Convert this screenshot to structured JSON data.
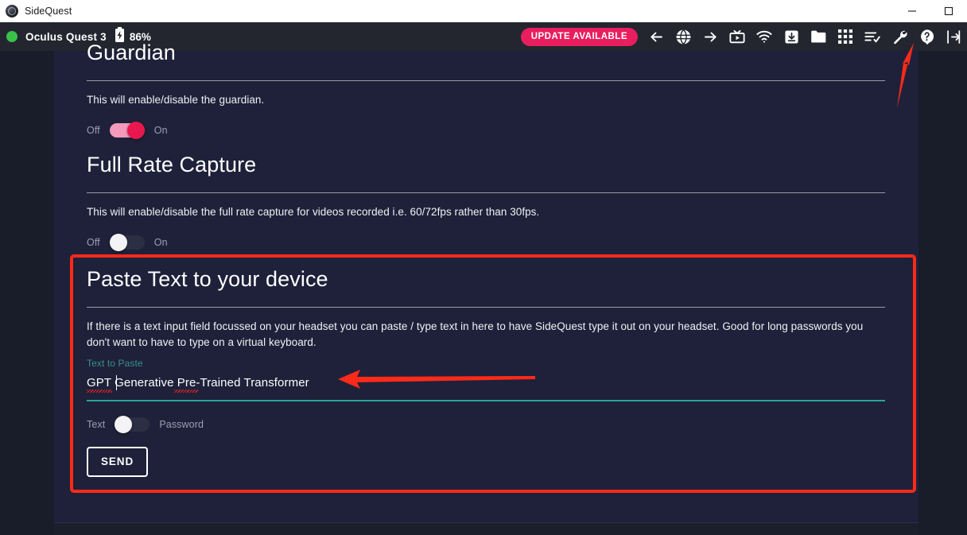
{
  "window": {
    "title": "SideQuest",
    "logo_icon": "sidequest-logo-icon",
    "minimize_label": "minimize-icon",
    "maximize_label": "maximize-icon"
  },
  "toolbar": {
    "status_icon": "connected-status-dot",
    "device_name": "Oculus Quest 3",
    "battery_icon": "battery-icon",
    "battery_percent": "86%",
    "update_badge": "UPDATE AVAILABLE",
    "icons": [
      {
        "name": "back-arrow-icon",
        "label": "Back"
      },
      {
        "name": "globe-icon",
        "label": "Browser"
      },
      {
        "name": "forward-arrow-icon",
        "label": "Forward"
      },
      {
        "name": "media-tv-icon",
        "label": "Media"
      },
      {
        "name": "wifi-icon",
        "label": "Wireless"
      },
      {
        "name": "download-icon",
        "label": "Downloads"
      },
      {
        "name": "folder-icon",
        "label": "Files"
      },
      {
        "name": "apps-grid-icon",
        "label": "Apps"
      },
      {
        "name": "task-list-icon",
        "label": "Tasks"
      },
      {
        "name": "wrench-icon",
        "label": "Tools"
      },
      {
        "name": "help-icon",
        "label": "Help"
      },
      {
        "name": "exit-icon",
        "label": "Exit"
      }
    ]
  },
  "sections": {
    "guardian": {
      "title": "Guardian",
      "description": "This will enable/disable the guardian.",
      "toggle": {
        "off_label": "Off",
        "on_label": "On",
        "state": "on"
      }
    },
    "full_rate_capture": {
      "title": "Full Rate Capture",
      "description": "This will enable/disable the full rate capture for videos recorded i.e. 60/72fps rather than 30fps.",
      "toggle": {
        "off_label": "Off",
        "on_label": "On",
        "state": "off"
      }
    },
    "paste_text": {
      "title": "Paste Text to your device",
      "description": "If there is a text input field focussed on your headset you can paste / type text in here to have SideQuest type it out on your headset. Good for long passwords you don't want to have to type on a virtual keyboard.",
      "field_label": "Text to Paste",
      "field_value": "GPT Generative Pre-Trained Transformer",
      "field_placeholder": "Text to Paste",
      "mode_toggle": {
        "text_label": "Text",
        "password_label": "Password",
        "state": "text"
      },
      "send_button": "SEND"
    }
  },
  "annotations": {
    "wrench_arrow": "red-arrow-pointing-to-wrench-icon",
    "field_arrow": "red-arrow-pointing-to-text-field",
    "panel_outline": "red-highlight-box-around-paste-text-section"
  },
  "colors": {
    "accent_pink": "#e8174f",
    "accent_teal": "#2aa39a",
    "annotation_red": "#fc2a19",
    "status_green": "#39c24a",
    "panel_bg": "#1e2139",
    "toolbar_bg": "#23262f"
  }
}
